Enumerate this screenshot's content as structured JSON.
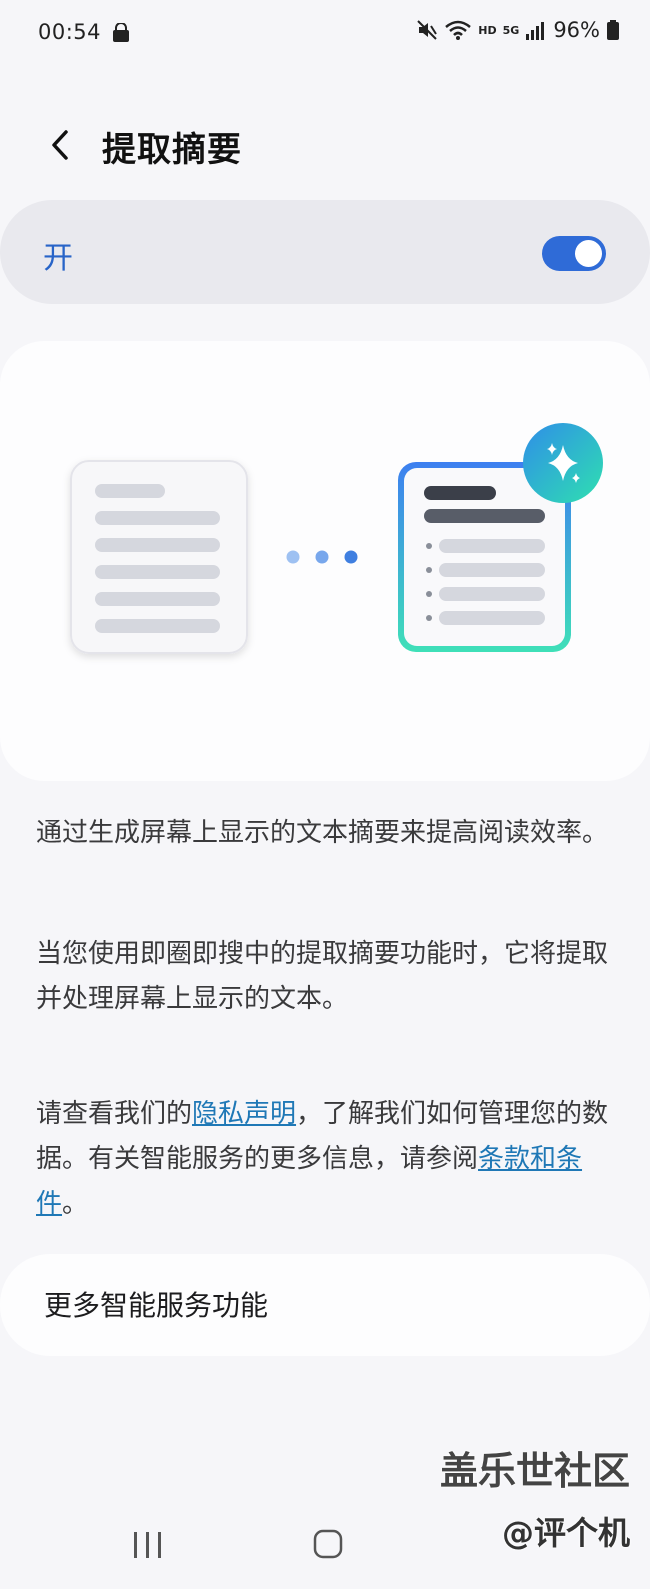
{
  "status_bar": {
    "time": "00:54",
    "network": "HD",
    "signal": "5G",
    "battery": "96%"
  },
  "header": {
    "title": "提取摘要"
  },
  "toggle": {
    "label": "开",
    "state": "on",
    "accent_color": "#2f6bd7"
  },
  "description": {
    "paragraph_1": "通过生成屏幕上显示的文本摘要来提高阅读效率。",
    "paragraph_2": "当您使用即圈即搜中的提取摘要功能时，它将提取并处理屏幕上显示的文本。"
  },
  "privacy": {
    "part_1": "请查看我们的",
    "privacy_link": "隐私声明",
    "part_2": "，了解我们如何管理您的数据。有关智能服务的更多信息，请参阅",
    "terms_link": "条款和条件",
    "part_3": "。"
  },
  "more": {
    "label": "更多智能服务功能"
  },
  "watermark": {
    "line_1": "盖乐世社区",
    "line_2": "@评个机"
  },
  "colors": {
    "link": "#1f78b6",
    "background": "#f6f6f9"
  }
}
